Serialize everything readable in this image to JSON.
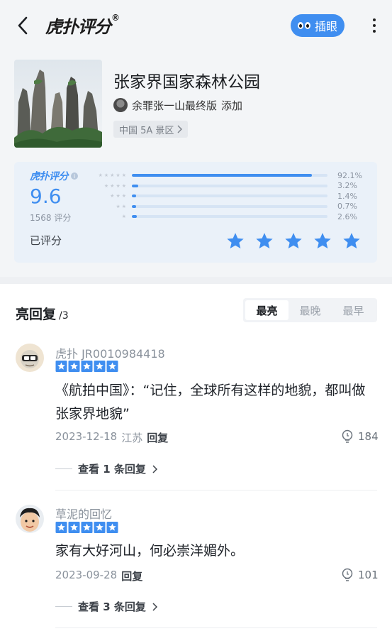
{
  "topbar": {
    "logo_text": "虎扑评分",
    "logo_reg": "®",
    "pill_label": "插眼"
  },
  "item": {
    "title": "张家界国家森林公园",
    "author": "余罪张一山最终版",
    "author_action": "添加",
    "tag": "中国 5A 景区"
  },
  "rating": {
    "logo_text": "虎扑评分",
    "score": "9.6",
    "count": "1568 评分",
    "rated_label": "已评分",
    "user_stars": 5,
    "distribution": [
      {
        "stars": 5,
        "pct_label": "92.1%",
        "value": 92.1
      },
      {
        "stars": 4,
        "pct_label": "3.2%",
        "value": 3.2
      },
      {
        "stars": 3,
        "pct_label": "1.4%",
        "value": 1.4
      },
      {
        "stars": 2,
        "pct_label": "0.7%",
        "value": 0.7
      },
      {
        "stars": 1,
        "pct_label": "2.6%",
        "value": 2.6
      }
    ]
  },
  "replies": {
    "title": "亮回复",
    "count": "/3",
    "sort_tabs": [
      "最亮",
      "最晚",
      "最早"
    ],
    "items": [
      {
        "name": "虎扑 JR0010984418",
        "stars": 5,
        "text": "《航拍中国》：“记住，全球所有这样的地貌，都叫做张家界地貌”",
        "date": "2023-12-18",
        "location": "江苏",
        "reply_label": "回复",
        "likes": "184",
        "more_replies": "查看 1 条回复"
      },
      {
        "name": "草泥的回忆",
        "stars": 5,
        "text": "家有大好河山，何必崇洋媚外。",
        "date": "2023-09-28",
        "location": "",
        "reply_label": "回复",
        "likes": "101",
        "more_replies": "查看 3 条回复"
      }
    ]
  },
  "colors": {
    "accent": "#3f8ef0",
    "header_bg": "#f3f5f7",
    "rating_bg": "#eaf1f9"
  }
}
